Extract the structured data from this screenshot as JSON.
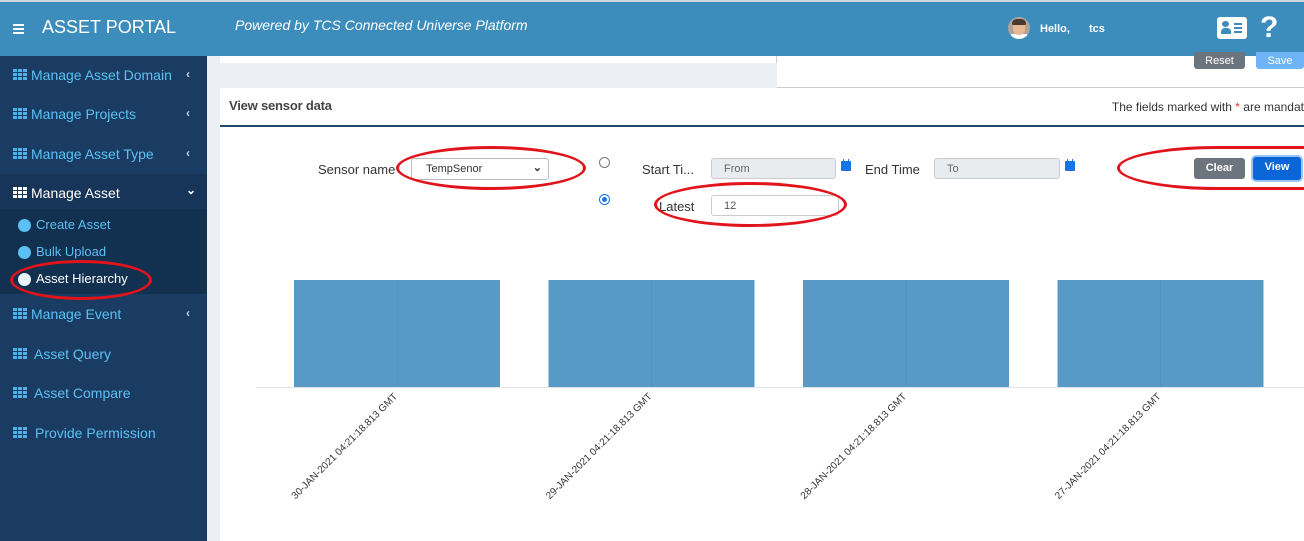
{
  "header": {
    "brand": "ASSET PORTAL",
    "powered_by": "Powered by TCS Connected Universe Platform",
    "greeting": "Hello,",
    "username": "tcs",
    "icons": [
      "menu-icon",
      "user-avatar",
      "id-card-icon",
      "help-icon"
    ]
  },
  "sidebar": {
    "items": [
      {
        "label": "Manage Asset Domain",
        "chevron": "‹"
      },
      {
        "label": "Manage Projects",
        "chevron": "‹"
      },
      {
        "label": "Manage Asset Type",
        "chevron": "‹"
      },
      {
        "label": "Manage Asset",
        "chevron": "⌄"
      },
      {
        "label": "Manage Event",
        "chevron": "‹"
      },
      {
        "label": "Asset Query"
      },
      {
        "label": "Asset Compare"
      },
      {
        "label": "Provide Permission"
      }
    ],
    "submenu": [
      {
        "label": "Create Asset"
      },
      {
        "label": "Bulk Upload"
      },
      {
        "label": "Asset Hierarchy"
      }
    ]
  },
  "top_panel": {
    "reset_label": "Reset",
    "save_label": "Save"
  },
  "panel": {
    "title": "View sensor data",
    "mandatory_prefix": "The fields marked with ",
    "mandatory_star": "*",
    "mandatory_suffix": " are mandat",
    "sensor_name_label": "Sensor name",
    "sensor_name_value": "TempSenor",
    "start_time_label": "Start Ti...",
    "start_time_placeholder": "From",
    "end_time_label": "End Time",
    "end_time_placeholder": "To",
    "latest_label": "Latest",
    "latest_value": "12",
    "mode_selected": "latest",
    "clear_label": "Clear",
    "view_label": "View"
  },
  "colors": {
    "header": "#3c8dbc",
    "sidebar": "#1a3c63",
    "bar": "#5799c7",
    "annotation": "#e2141b",
    "primary": "#0a66d6"
  },
  "chart_data": {
    "type": "bar",
    "title": "",
    "xlabel": "",
    "ylabel": "",
    "categories": [
      "30-JAN-2021 04:21:18.813 GMT",
      "29-JAN-2021 04:21:18.813 GMT",
      "28-JAN-2021 04:21:18.813 GMT",
      "27-JAN-2021 04:21:18.813 GMT"
    ],
    "values": [
      1,
      1,
      1,
      1
    ],
    "ylim": [
      0,
      1
    ],
    "grid": false,
    "legend": "none"
  }
}
